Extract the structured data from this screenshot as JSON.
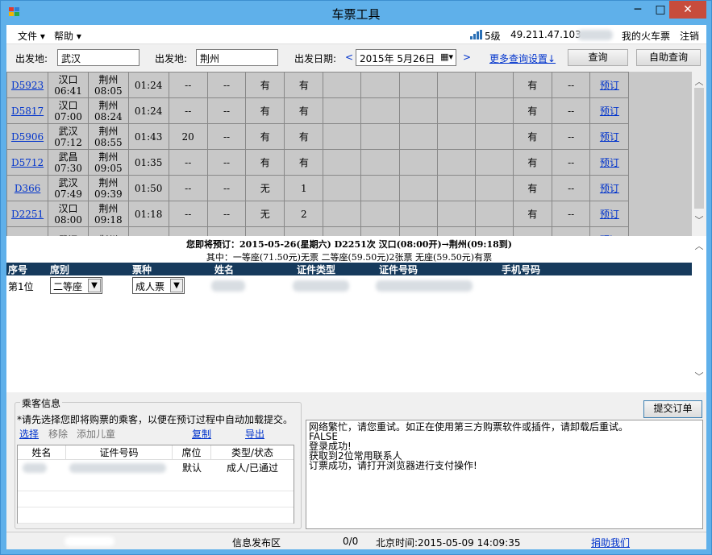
{
  "window": {
    "title": "车票工具",
    "minimize": "─",
    "maximize": "□",
    "close": "✕"
  },
  "menu": {
    "file": "文件 ▾",
    "help": "帮助 ▾",
    "signal": "5级",
    "ip": "49.211.47.103",
    "my_tickets": "我的火车票",
    "logout": "注销"
  },
  "query": {
    "from_label": "出发地:",
    "from_value": "武汉",
    "to_label": "出发地:",
    "to_value": "荆州",
    "date_label": "出发日期:",
    "prev": "<",
    "date_value": "2015年  5月26日",
    "next": ">",
    "more_settings": "更多查询设置↓",
    "query_btn": "查询",
    "auto_query_btn": "自助查询"
  },
  "trains": [
    {
      "no": "D5923",
      "from": "汉口",
      "dep": "06:41",
      "to": "荆州",
      "arr": "08:05",
      "dur": "01:24",
      "c1": "--",
      "c2": "--",
      "c3": "有",
      "c4": "有",
      "c5": "",
      "c6": "",
      "c7": "",
      "c8": "",
      "c9": "",
      "c10": "有",
      "c11": "--",
      "book": "预订"
    },
    {
      "no": "D5817",
      "from": "汉口",
      "dep": "07:00",
      "to": "荆州",
      "arr": "08:24",
      "dur": "01:24",
      "c1": "--",
      "c2": "--",
      "c3": "有",
      "c4": "有",
      "c5": "",
      "c6": "",
      "c7": "",
      "c8": "",
      "c9": "",
      "c10": "有",
      "c11": "--",
      "book": "预订"
    },
    {
      "no": "D5906",
      "from": "武汉",
      "dep": "07:12",
      "to": "荆州",
      "arr": "08:55",
      "dur": "01:43",
      "c1": "20",
      "c2": "--",
      "c3": "有",
      "c4": "有",
      "c5": "",
      "c6": "",
      "c7": "",
      "c8": "",
      "c9": "",
      "c10": "有",
      "c11": "--",
      "book": "预订"
    },
    {
      "no": "D5712",
      "from": "武昌",
      "dep": "07:30",
      "to": "荆州",
      "arr": "09:05",
      "dur": "01:35",
      "c1": "--",
      "c2": "--",
      "c3": "有",
      "c4": "有",
      "c5": "",
      "c6": "",
      "c7": "",
      "c8": "",
      "c9": "",
      "c10": "有",
      "c11": "--",
      "book": "预订"
    },
    {
      "no": "D366",
      "from": "武汉",
      "dep": "07:49",
      "to": "荆州",
      "arr": "09:39",
      "dur": "01:50",
      "c1": "--",
      "c2": "--",
      "c3": "无",
      "c4": "1",
      "c5": "",
      "c6": "",
      "c7": "",
      "c8": "",
      "c9": "",
      "c10": "有",
      "c11": "--",
      "book": "预订"
    },
    {
      "no": "D2251",
      "from": "汉口",
      "dep": "08:00",
      "to": "荆州",
      "arr": "09:18",
      "dur": "01:18",
      "c1": "--",
      "c2": "--",
      "c3": "无",
      "c4": "2",
      "c5": "",
      "c6": "",
      "c7": "",
      "c8": "",
      "c9": "",
      "c10": "有",
      "c11": "--",
      "book": "预订"
    },
    {
      "no": "",
      "from": "武汉",
      "dep": "",
      "to": "荆州",
      "arr": "",
      "dur": "",
      "c1": "",
      "c2": "",
      "c3": "",
      "c4": "",
      "c5": "",
      "c6": "",
      "c7": "",
      "c8": "",
      "c9": "",
      "c10": "",
      "c11": "",
      "book": "预订"
    }
  ],
  "booking": {
    "line1": "您即将预订：2015-05-26(星期六) D2251次 汉口(08:00开)→荆州(09:18到)",
    "line2": "其中：一等座(71.50元)无票 二等座(59.50元)2张票 无座(59.50元)有票",
    "headers": {
      "no": "序号",
      "seat": "席别",
      "type": "票种",
      "name": "姓名",
      "id_type": "证件类型",
      "id_no": "证件号码",
      "phone": "手机号码"
    },
    "row": {
      "no": "第1位",
      "seat": "二等座",
      "type": "成人票"
    }
  },
  "passenger": {
    "group_title": "乘客信息",
    "hint": "*请先选择您即将购票的乘客，以便在预订过程中自动加载提交。",
    "select": "选择",
    "remove": "移除",
    "add_child": "添加儿童",
    "copy": "复制",
    "export": "导出",
    "headers": {
      "name": "姓名",
      "id_no": "证件号码",
      "seat": "席位",
      "status": "类型/状态"
    },
    "row": {
      "seat": "默认",
      "status": "成人/已通过"
    }
  },
  "submit_btn": "提交订单",
  "log": [
    "网络繁忙，请您重试。如正在使用第三方购票软件或插件，请卸载后重试。",
    "FALSE",
    "登录成功!",
    "获取到2位常用联系人",
    "订票成功，请打开浏览器进行支付操作!"
  ],
  "status": {
    "info": "信息发布区",
    "count": "0/0",
    "time": "北京时间:2015-05-09 14:09:35",
    "donate": "捐助我们"
  }
}
